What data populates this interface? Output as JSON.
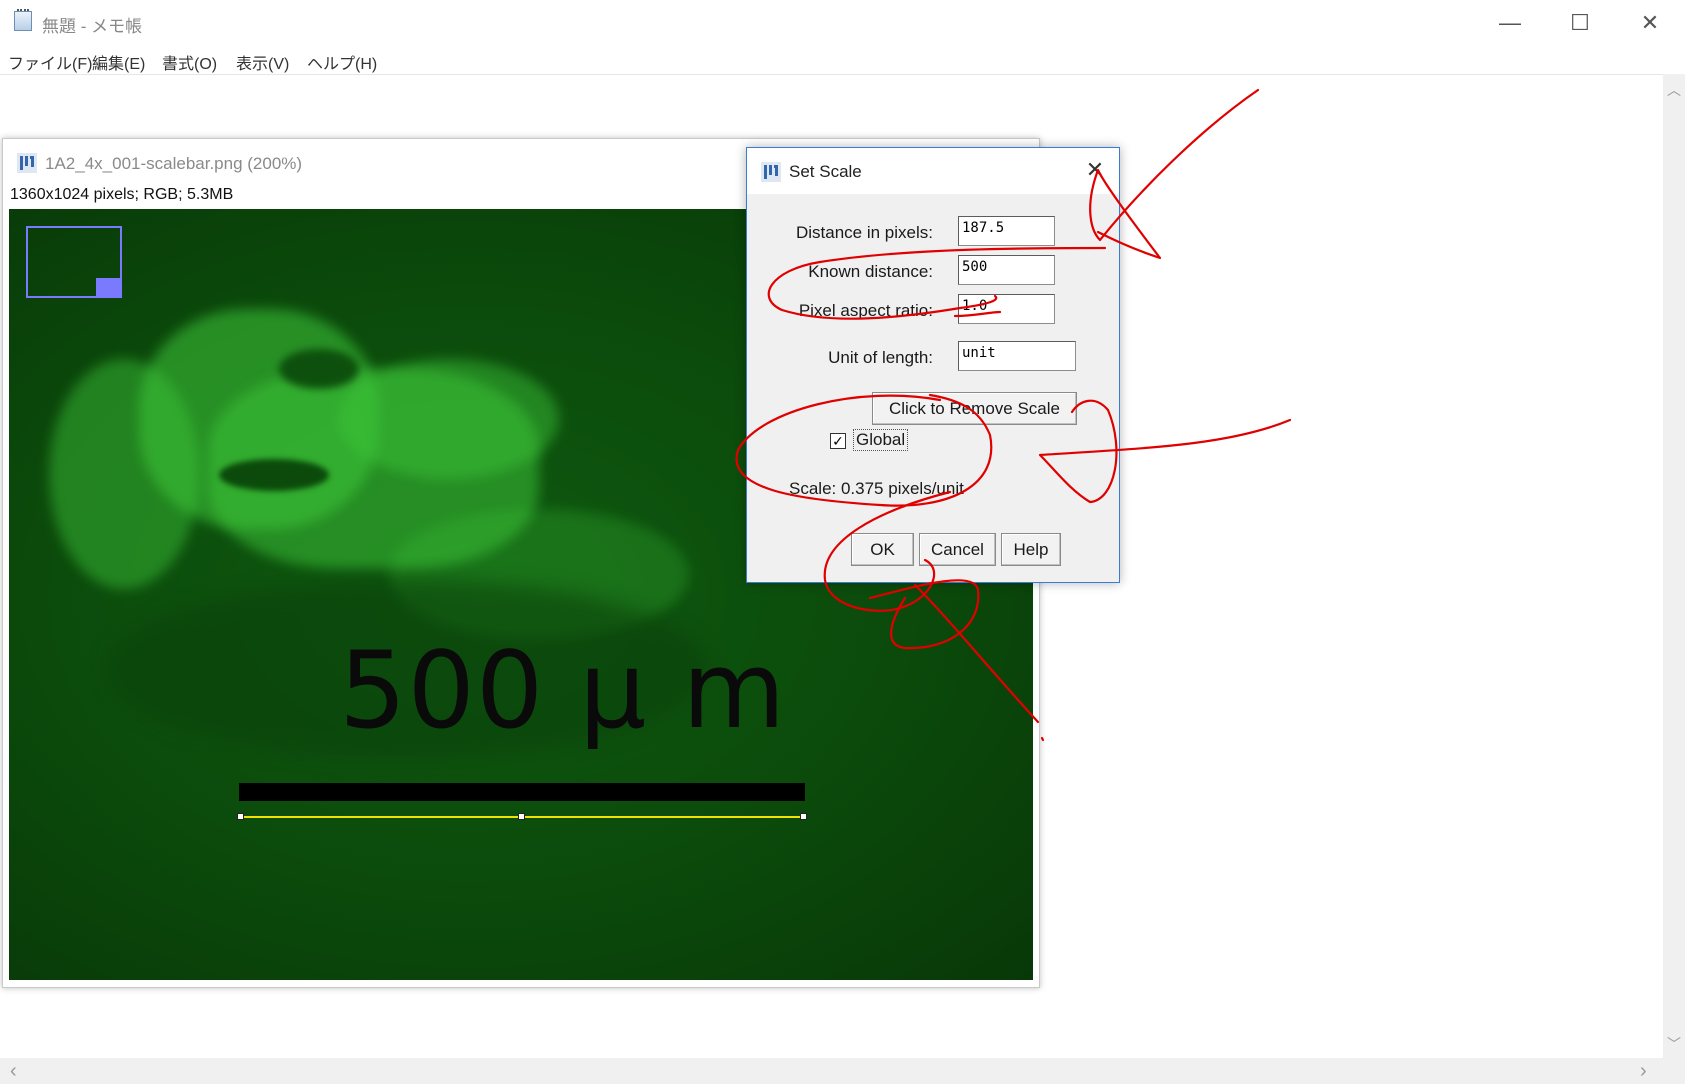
{
  "notepad": {
    "title": "無題 - メモ帳",
    "menu": [
      "ファイル(F)",
      "編集(E)",
      "書式(O)",
      "表示(V)",
      "ヘルプ(H)"
    ],
    "minimize_glyph": "—",
    "maximize_glyph": "☐",
    "close_glyph": "✕",
    "scroll_up_glyph": "︿",
    "scroll_down_glyph": "﹀",
    "scroll_left_glyph": "‹",
    "scroll_right_glyph": "›"
  },
  "image_window": {
    "title": "1A2_4x_001-scalebar.png (200%)",
    "info": "1360x1024 pixels; RGB; 5.3MB",
    "scalebar_label": "500 μ m"
  },
  "dialog": {
    "title": "Set Scale",
    "close_glyph": "✕",
    "fields": [
      {
        "label": "Distance in pixels:",
        "value": "187.5"
      },
      {
        "label": "Known distance:",
        "value": "500"
      },
      {
        "label": "Pixel aspect ratio:",
        "value": "1.0"
      },
      {
        "label": "Unit of length:",
        "value": "unit"
      }
    ],
    "remove_scale_label": "Click to Remove Scale",
    "global_label": "Global",
    "global_checked": "✓",
    "scale_text": "Scale: 0.375 pixels/unit",
    "buttons": {
      "ok": "OK",
      "cancel": "Cancel",
      "help": "Help"
    }
  },
  "colors": {
    "annotation": "#e00000",
    "dialog_border": "#3a7bd5",
    "roi_line": "#f2e200",
    "navigator": "#7a7aff"
  }
}
